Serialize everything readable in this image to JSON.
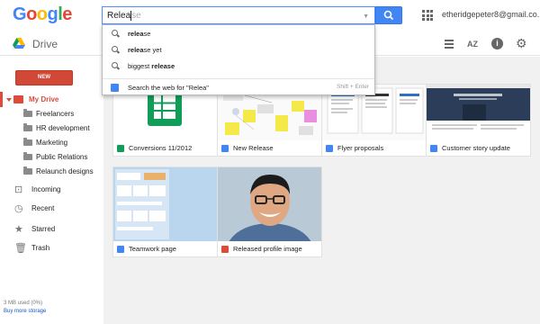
{
  "header": {
    "logo_letters": [
      {
        "ch": "G",
        "color": "#4285f4"
      },
      {
        "ch": "o",
        "color": "#ea4335"
      },
      {
        "ch": "o",
        "color": "#fbbc05"
      },
      {
        "ch": "g",
        "color": "#4285f4"
      },
      {
        "ch": "l",
        "color": "#34a853"
      },
      {
        "ch": "e",
        "color": "#ea4335"
      }
    ],
    "search_typed": "Relea",
    "search_ghost": "se",
    "user_email": "etheridgepeter8@gmail.co..."
  },
  "drivebar": {
    "label": "Drive",
    "sort_label": "AZ",
    "info_label": "i"
  },
  "autocomplete": {
    "suggestions": [
      {
        "bold": "relea",
        "rest": "se",
        "post": ""
      },
      {
        "bold": "relea",
        "rest": "se yet",
        "post": ""
      },
      {
        "bold": "",
        "rest": "biggest ",
        "post": "release",
        "post_bold": true
      }
    ],
    "web_search_label": "Search the web for \"Relea\"",
    "web_search_shortcut": "Shift + Enter"
  },
  "sidebar": {
    "new_label": "NEW",
    "my_drive": "My Drive",
    "folders": [
      "Freelancers",
      "HR development",
      "Marketing",
      "Public Relations",
      "Relaunch designs"
    ],
    "incoming": "Incoming",
    "recent": "Recent",
    "starred": "Starred",
    "trash": "Trash",
    "storage_used": "3 MB used (0%)",
    "buy_storage": "Buy more storage"
  },
  "files": [
    {
      "name": "Conversions 11/2012",
      "kind": "sheet",
      "icon_color": "#0f9d58"
    },
    {
      "name": "New Release",
      "kind": "drawing",
      "icon_color": "#4285f4"
    },
    {
      "name": "Flyer proposals",
      "kind": "doc",
      "icon_color": "#4285f4"
    },
    {
      "name": "Customer story update",
      "kind": "site",
      "icon_color": "#4285f4"
    },
    {
      "name": "Teamwork page",
      "kind": "teamwork",
      "icon_color": "#4285f4"
    },
    {
      "name": "Released profile image",
      "kind": "photo",
      "icon_color": "#dd4b39"
    }
  ],
  "colors": {
    "accent_red": "#dd4b39",
    "search_blue": "#4285f4",
    "link_blue": "#1155cc"
  }
}
